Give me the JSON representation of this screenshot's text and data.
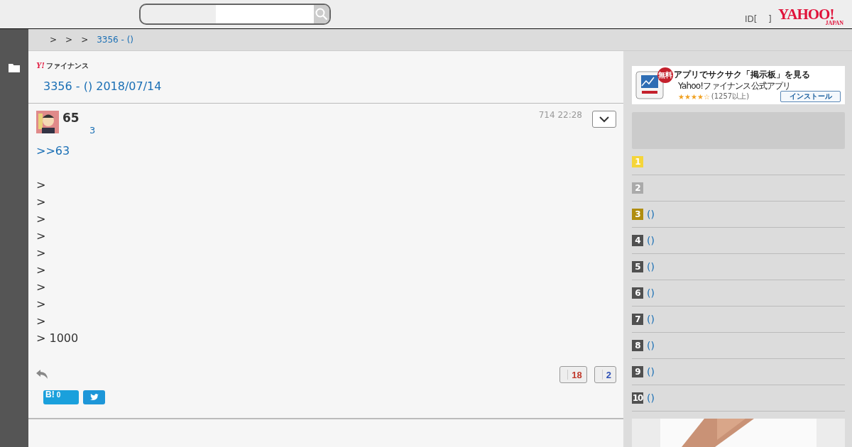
{
  "header": {
    "login": {
      "prefix": "ID[",
      "suffix": "]"
    },
    "logo": {
      "main": "YAHOO!",
      "sub": "JAPAN"
    }
  },
  "breadcrumb": [
    {
      "label": ">",
      "link": false
    },
    {
      "label": ">",
      "link": false
    },
    {
      "label": ">",
      "link": false
    },
    {
      "label": "3356 - ()",
      "link": true
    }
  ],
  "board": {
    "logo_mark": "Y!",
    "logo_text": "ファイナンス",
    "title": "3356 - () 2018/07/14"
  },
  "post": {
    "number": "65",
    "reply_count": "3",
    "time": "714 22:28",
    "lines": [
      {
        "text": ">>63",
        "kind": "link"
      },
      {
        "kind": "blank"
      },
      {
        "text": ">",
        "kind": "plain"
      },
      {
        "text": ">",
        "kind": "plain"
      },
      {
        "text": ">",
        "kind": "plain"
      },
      {
        "text": ">",
        "kind": "plain"
      },
      {
        "text": ">",
        "kind": "plain"
      },
      {
        "text": ">",
        "kind": "plain"
      },
      {
        "text": ">",
        "kind": "plain"
      },
      {
        "text": ">",
        "kind": "plain"
      },
      {
        "text": ">",
        "kind": "plain"
      },
      {
        "text": "> 1000",
        "kind": "plain"
      }
    ],
    "likes": "18",
    "dislikes": "2",
    "hatena_mark": "B!",
    "hatena_count": "0"
  },
  "ad": {
    "badge": "無料",
    "title": "アプリでサクサク「掲示板」を見る",
    "subtitle": "Yahoo!ファイナンス公式アプリ",
    "stars": 4,
    "rating_count": "(1257以上)",
    "button": "インストール"
  },
  "ranking": [
    {
      "rank": "1",
      "color": "#f5d53a"
    },
    {
      "rank": "2",
      "color": "#aaaaaa"
    },
    {
      "rank": "3",
      "label": "()",
      "color": "#b08d10"
    },
    {
      "rank": "4",
      "label": "()",
      "color": "#505050"
    },
    {
      "rank": "5",
      "label": "()",
      "color": "#505050"
    },
    {
      "rank": "6",
      "label": "()",
      "color": "#505050"
    },
    {
      "rank": "7",
      "label": "()",
      "color": "#505050"
    },
    {
      "rank": "8",
      "label": "()",
      "color": "#505050"
    },
    {
      "rank": "9",
      "label": "()",
      "color": "#505050"
    },
    {
      "rank": "10",
      "label": "()",
      "color": "#505050"
    }
  ]
}
